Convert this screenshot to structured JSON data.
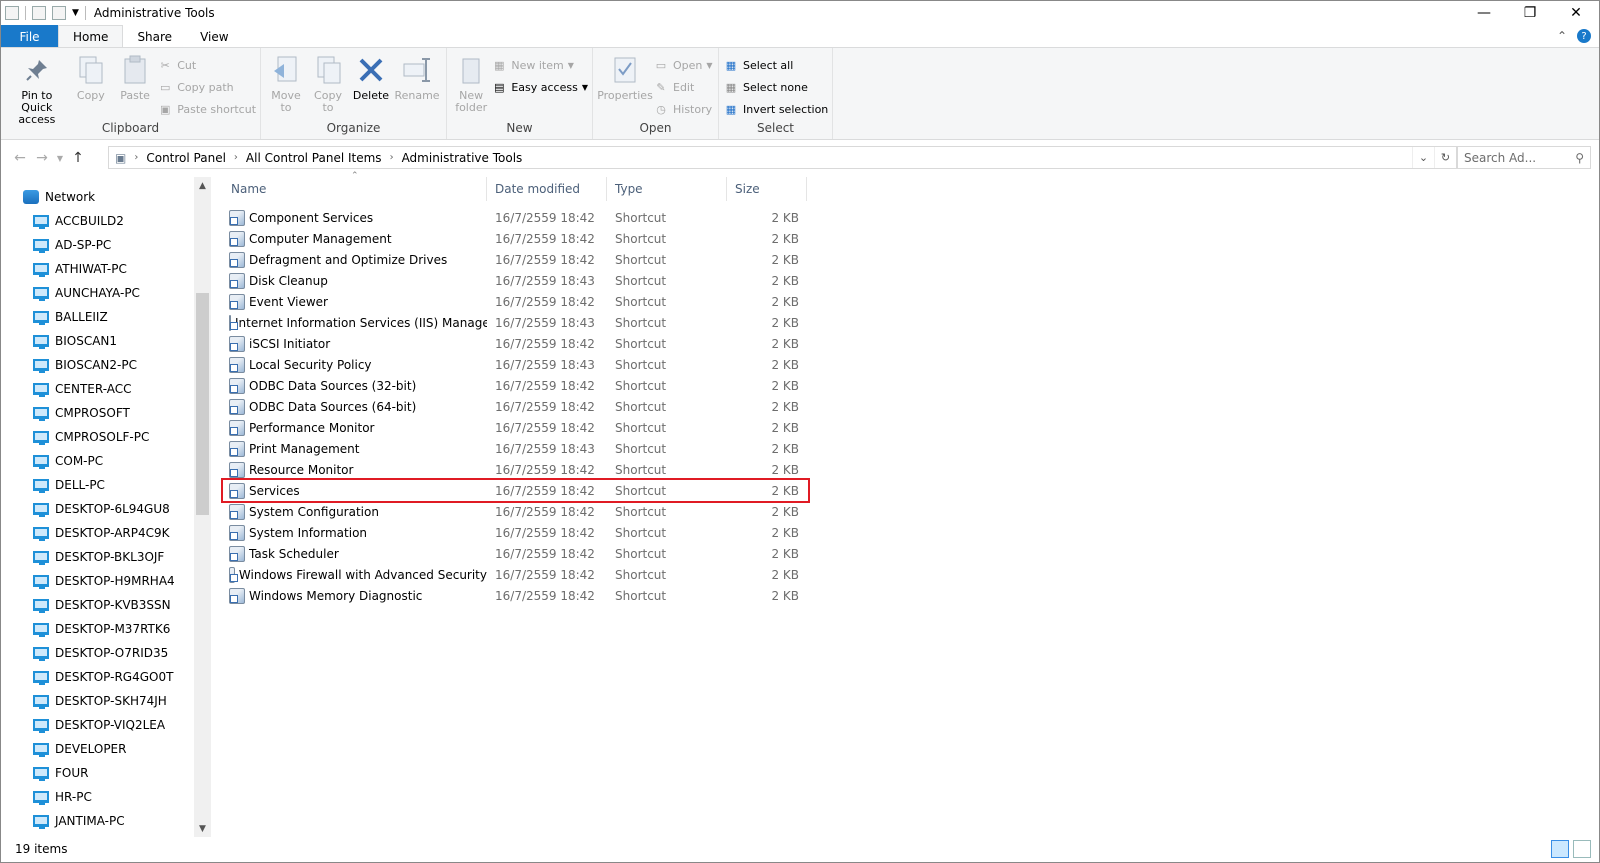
{
  "window": {
    "title": "Administrative Tools"
  },
  "tabs": [
    {
      "label": "File"
    },
    {
      "label": "Home"
    },
    {
      "label": "Share"
    },
    {
      "label": "View"
    }
  ],
  "ribbon": {
    "clipboard": {
      "label": "Clipboard",
      "pin": "Pin to Quick access",
      "copy": "Copy",
      "paste": "Paste",
      "cut": "Cut",
      "copy_path": "Copy path",
      "paste_shortcut": "Paste shortcut"
    },
    "organize": {
      "label": "Organize",
      "move_to": "Move to",
      "copy_to": "Copy to",
      "delete": "Delete",
      "rename": "Rename"
    },
    "new": {
      "label": "New",
      "new_folder": "New folder",
      "new_item": "New item",
      "easy_access": "Easy access"
    },
    "open": {
      "label": "Open",
      "properties": "Properties",
      "open": "Open",
      "edit": "Edit",
      "history": "History"
    },
    "select": {
      "label": "Select",
      "select_all": "Select all",
      "select_none": "Select none",
      "invert": "Invert selection"
    }
  },
  "address": {
    "crumbs": [
      "Control Panel",
      "All Control Panel Items",
      "Administrative Tools"
    ],
    "search_placeholder": "Search Ad..."
  },
  "nav": {
    "root": "Network",
    "items": [
      "ACCBUILD2",
      "AD-SP-PC",
      "ATHIWAT-PC",
      "AUNCHAYA-PC",
      "BALLEIIZ",
      "BIOSCAN1",
      "BIOSCAN2-PC",
      "CENTER-ACC",
      "CMPROSOFT",
      "CMPROSOLF-PC",
      "COM-PC",
      "DELL-PC",
      "DESKTOP-6L94GU8",
      "DESKTOP-ARP4C9K",
      "DESKTOP-BKL3OJF",
      "DESKTOP-H9MRHA4",
      "DESKTOP-KVB3SSN",
      "DESKTOP-M37RTK6",
      "DESKTOP-O7RID35",
      "DESKTOP-RG4GO0T",
      "DESKTOP-SKH74JH",
      "DESKTOP-VIQ2LEA",
      "DEVELOPER",
      "FOUR",
      "HR-PC",
      "JANTIMA-PC"
    ]
  },
  "columns": {
    "name": "Name",
    "date": "Date modified",
    "type": "Type",
    "size": "Size"
  },
  "files": [
    {
      "name": "Component Services",
      "date": "16/7/2559 18:42",
      "type": "Shortcut",
      "size": "2 KB"
    },
    {
      "name": "Computer Management",
      "date": "16/7/2559 18:42",
      "type": "Shortcut",
      "size": "2 KB"
    },
    {
      "name": "Defragment and Optimize Drives",
      "date": "16/7/2559 18:42",
      "type": "Shortcut",
      "size": "2 KB"
    },
    {
      "name": "Disk Cleanup",
      "date": "16/7/2559 18:43",
      "type": "Shortcut",
      "size": "2 KB"
    },
    {
      "name": "Event Viewer",
      "date": "16/7/2559 18:42",
      "type": "Shortcut",
      "size": "2 KB"
    },
    {
      "name": "Internet Information Services (IIS) Manager",
      "date": "16/7/2559 18:43",
      "type": "Shortcut",
      "size": "2 KB"
    },
    {
      "name": "iSCSI Initiator",
      "date": "16/7/2559 18:42",
      "type": "Shortcut",
      "size": "2 KB"
    },
    {
      "name": "Local Security Policy",
      "date": "16/7/2559 18:43",
      "type": "Shortcut",
      "size": "2 KB"
    },
    {
      "name": "ODBC Data Sources (32-bit)",
      "date": "16/7/2559 18:42",
      "type": "Shortcut",
      "size": "2 KB"
    },
    {
      "name": "ODBC Data Sources (64-bit)",
      "date": "16/7/2559 18:42",
      "type": "Shortcut",
      "size": "2 KB"
    },
    {
      "name": "Performance Monitor",
      "date": "16/7/2559 18:42",
      "type": "Shortcut",
      "size": "2 KB"
    },
    {
      "name": "Print Management",
      "date": "16/7/2559 18:43",
      "type": "Shortcut",
      "size": "2 KB"
    },
    {
      "name": "Resource Monitor",
      "date": "16/7/2559 18:42",
      "type": "Shortcut",
      "size": "2 KB"
    },
    {
      "name": "Services",
      "date": "16/7/2559 18:42",
      "type": "Shortcut",
      "size": "2 KB",
      "highlighted": true
    },
    {
      "name": "System Configuration",
      "date": "16/7/2559 18:42",
      "type": "Shortcut",
      "size": "2 KB"
    },
    {
      "name": "System Information",
      "date": "16/7/2559 18:42",
      "type": "Shortcut",
      "size": "2 KB"
    },
    {
      "name": "Task Scheduler",
      "date": "16/7/2559 18:42",
      "type": "Shortcut",
      "size": "2 KB"
    },
    {
      "name": "Windows Firewall with Advanced Security",
      "date": "16/7/2559 18:42",
      "type": "Shortcut",
      "size": "2 KB"
    },
    {
      "name": "Windows Memory Diagnostic",
      "date": "16/7/2559 18:42",
      "type": "Shortcut",
      "size": "2 KB"
    }
  ],
  "status": {
    "items": "19 items"
  },
  "colors": {
    "accent": "#1979ca",
    "highlight": "#e01b24"
  }
}
